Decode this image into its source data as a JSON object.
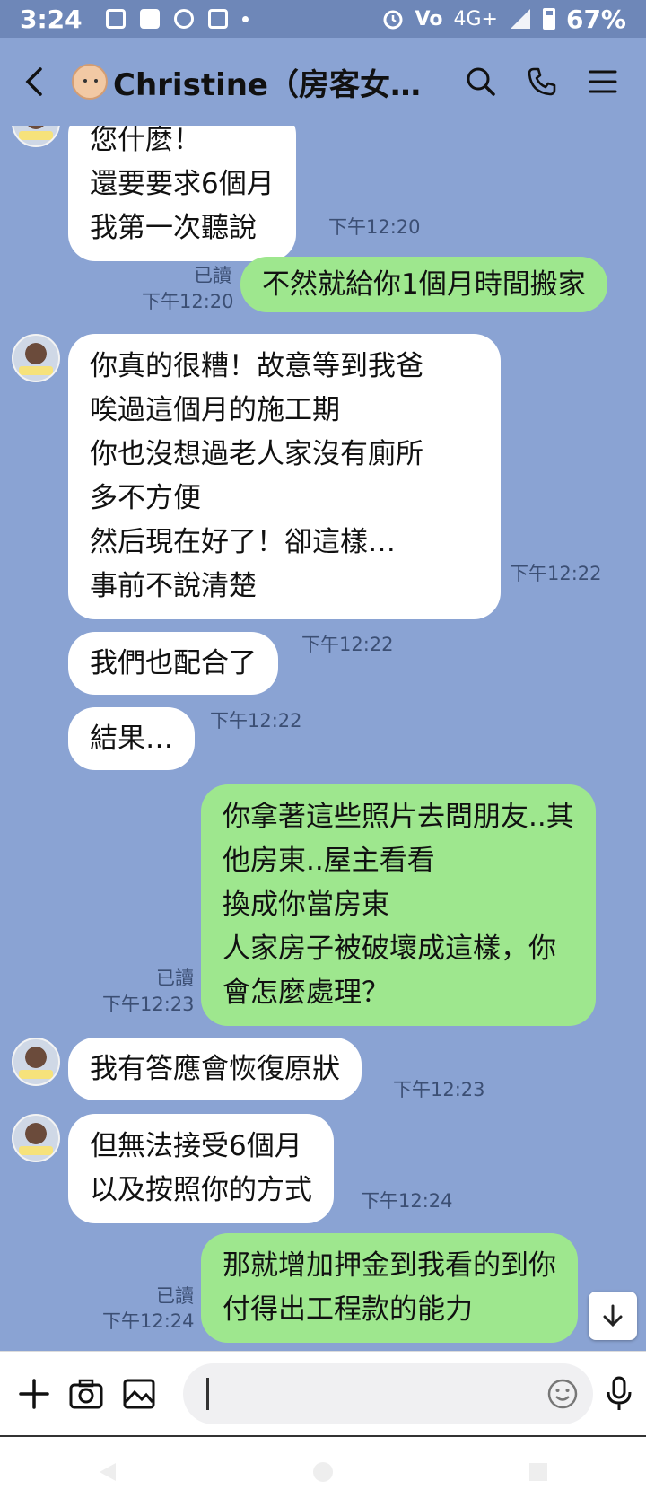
{
  "status_bar": {
    "time": "3:24",
    "network": "4G+",
    "battery": "67%"
  },
  "header": {
    "title": "Christine（房客女…",
    "avatar_icon": "baby-face-icon"
  },
  "messages": [
    {
      "side": "in",
      "lines": [
        "您什麼！",
        "還要要求6個月",
        "我第一次聽說"
      ],
      "time": "下午12:20"
    },
    {
      "side": "out",
      "lines": [
        "不然就給你1個月時間搬家"
      ],
      "read": "已讀",
      "time": "下午12:20"
    },
    {
      "side": "in",
      "lines": [
        "你真的很糟！故意等到我爸",
        "唉過這個月的施工期",
        "你也沒想過老人家沒有廁所",
        "多不方便",
        "然后現在好了！卻這樣…",
        "事前不說清楚"
      ],
      "time": "下午12:22"
    },
    {
      "side": "in",
      "lines": [
        "我們也配合了"
      ],
      "time": "下午12:22"
    },
    {
      "side": "in",
      "lines": [
        "結果…"
      ],
      "time": "下午12:22"
    },
    {
      "side": "out",
      "lines": [
        "你拿著這些照片去問朋友..其",
        "他房東..屋主看看",
        "換成你當房東",
        "人家房子被破壞成這樣，你",
        "會怎麼處理？"
      ],
      "read": "已讀",
      "time": "下午12:23"
    },
    {
      "side": "in",
      "lines": [
        "我有答應會恢復原狀"
      ],
      "time": "下午12:23"
    },
    {
      "side": "in",
      "lines": [
        "但無法接受6個月",
        "以及按照你的方式"
      ],
      "time": "下午12:24"
    },
    {
      "side": "out",
      "lines": [
        "那就增加押金到我看的到你",
        "付得出工程款的能力"
      ],
      "read": "已讀",
      "time": "下午12:24"
    }
  ],
  "input": {
    "placeholder": ""
  },
  "colors": {
    "background": "#8aa3d3",
    "outgoing": "#9ee78e",
    "incoming": "#ffffff"
  }
}
